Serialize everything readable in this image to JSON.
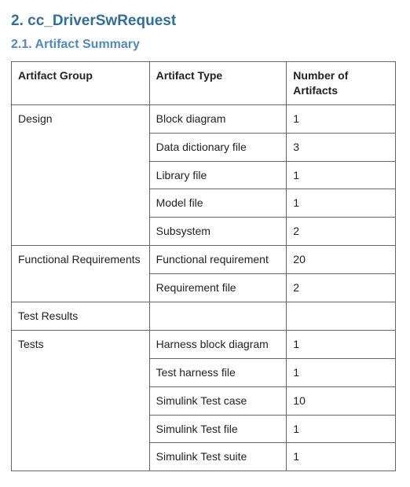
{
  "headings": {
    "section": "2. cc_DriverSwRequest",
    "subsection": "2.1. Artifact Summary"
  },
  "table": {
    "headers": {
      "group": "Artifact Group",
      "type": "Artifact Type",
      "count": "Number of Artifacts"
    },
    "groups": [
      {
        "name": "Design",
        "rows": [
          {
            "type": "Block diagram",
            "count": "1"
          },
          {
            "type": "Data dictionary file",
            "count": "3"
          },
          {
            "type": "Library file",
            "count": "1"
          },
          {
            "type": "Model file",
            "count": "1"
          },
          {
            "type": "Subsystem",
            "count": "2"
          }
        ]
      },
      {
        "name": "Functional Requirements",
        "rows": [
          {
            "type": "Functional requirement",
            "count": "20"
          },
          {
            "type": "Requirement file",
            "count": "2"
          }
        ]
      },
      {
        "name": "Test Results",
        "rows": [
          {
            "type": "",
            "count": ""
          }
        ]
      },
      {
        "name": "Tests",
        "rows": [
          {
            "type": "Harness block diagram",
            "count": "1"
          },
          {
            "type": "Test harness file",
            "count": "1"
          },
          {
            "type": "Simulink Test case",
            "count": "10"
          },
          {
            "type": "Simulink Test file",
            "count": "1"
          },
          {
            "type": "Simulink Test suite",
            "count": "1"
          }
        ]
      }
    ]
  },
  "chart_data": {
    "type": "table",
    "title": "Artifact Summary",
    "columns": [
      "Artifact Group",
      "Artifact Type",
      "Number of Artifacts"
    ],
    "rows": [
      [
        "Design",
        "Block diagram",
        1
      ],
      [
        "Design",
        "Data dictionary file",
        3
      ],
      [
        "Design",
        "Library file",
        1
      ],
      [
        "Design",
        "Model file",
        1
      ],
      [
        "Design",
        "Subsystem",
        2
      ],
      [
        "Functional Requirements",
        "Functional requirement",
        20
      ],
      [
        "Functional Requirements",
        "Requirement file",
        2
      ],
      [
        "Test Results",
        "",
        null
      ],
      [
        "Tests",
        "Harness block diagram",
        1
      ],
      [
        "Tests",
        "Test harness file",
        1
      ],
      [
        "Tests",
        "Simulink Test case",
        10
      ],
      [
        "Tests",
        "Simulink Test file",
        1
      ],
      [
        "Tests",
        "Simulink Test suite",
        1
      ]
    ]
  }
}
